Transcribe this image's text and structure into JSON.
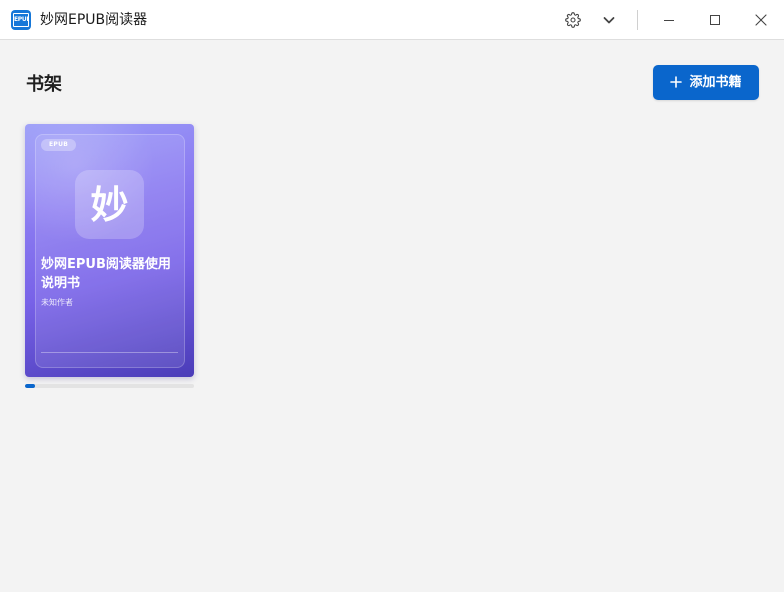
{
  "titlebar": {
    "app_icon_text": "EPUB",
    "app_title": "妙网EPUB阅读器",
    "settings_icon": "gear-icon",
    "menu_icon": "chevron-down-icon",
    "minimize_icon": "minimize-icon",
    "maximize_icon": "maximize-icon",
    "close_icon": "close-icon"
  },
  "header": {
    "title": "书架",
    "add_button_label": "添加书籍",
    "add_button_icon": "plus-icon"
  },
  "books": [
    {
      "format_badge": "EPUB",
      "cover_logo_char": "妙",
      "title": "妙网EPUB阅读器使用说明书",
      "author": "未知作者",
      "progress": 0.06
    }
  ],
  "colors": {
    "accent": "#0a66cc",
    "window_background": "#f3f3f3",
    "titlebar_background": "#ffffff",
    "cover_gradient_start": "#9c9ef8",
    "cover_gradient_end": "#4a3cb8"
  }
}
